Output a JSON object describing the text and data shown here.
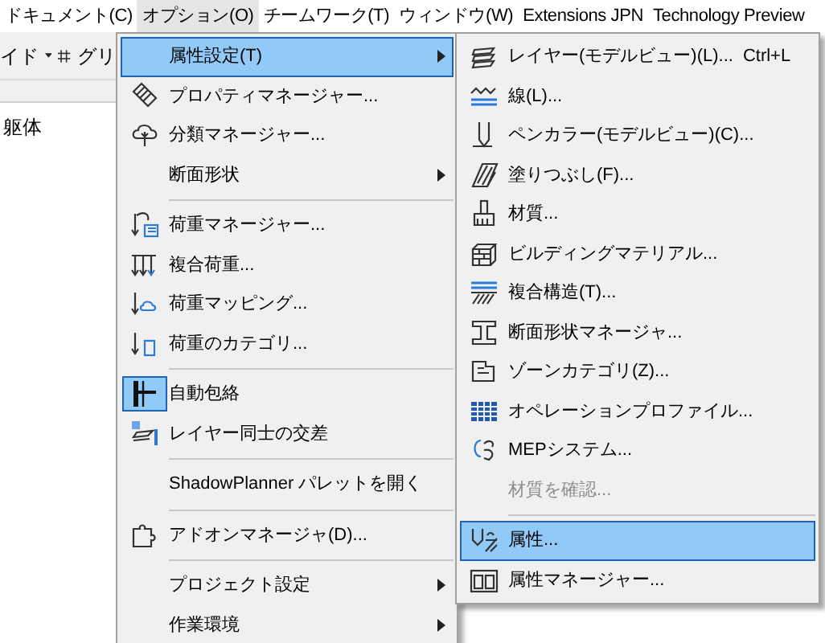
{
  "menubar": [
    {
      "label": "ドキュメント(C)",
      "selected": false
    },
    {
      "label": "オプション(O)",
      "selected": true
    },
    {
      "label": "チームワーク(T)",
      "selected": false
    },
    {
      "label": "ウィンドウ(W)",
      "selected": false
    },
    {
      "label": "Extensions JPN",
      "selected": false
    },
    {
      "label": "Technology Preview",
      "selected": false
    }
  ],
  "toolbar": {
    "left_label": "イド",
    "grid_label": "グリ"
  },
  "tree": {
    "item": "躯体"
  },
  "options_menu": {
    "groups": [
      [
        {
          "label": "属性設定(T)",
          "submenu": true,
          "selected": true,
          "checked": false
        },
        {
          "label": "プロパティマネージャー...",
          "submenu": false,
          "selected": false,
          "checked": false
        },
        {
          "label": "分類マネージャー...",
          "submenu": false,
          "selected": false,
          "checked": false
        },
        {
          "label": "断面形状",
          "submenu": true,
          "selected": false,
          "checked": false
        }
      ],
      [
        {
          "label": "荷重マネージャー...",
          "submenu": false,
          "selected": false,
          "checked": false
        },
        {
          "label": "複合荷重...",
          "submenu": false,
          "selected": false,
          "checked": false
        },
        {
          "label": "荷重マッピング...",
          "submenu": false,
          "selected": false,
          "checked": false
        },
        {
          "label": "荷重のカテゴリ...",
          "submenu": false,
          "selected": false,
          "checked": false
        }
      ],
      [
        {
          "label": "自動包絡",
          "submenu": false,
          "selected": false,
          "checked": true
        },
        {
          "label": "レイヤー同士の交差",
          "submenu": false,
          "selected": false,
          "checked": false
        }
      ],
      [
        {
          "label": "ShadowPlanner パレットを開く",
          "submenu": false,
          "selected": false,
          "checked": false
        }
      ],
      [
        {
          "label": "アドオンマネージャ(D)...",
          "submenu": false,
          "selected": false,
          "checked": false
        }
      ],
      [
        {
          "label": "プロジェクト設定",
          "submenu": true,
          "selected": false,
          "checked": false
        },
        {
          "label": "作業環境",
          "submenu": true,
          "selected": false,
          "checked": false
        }
      ]
    ]
  },
  "attributes_submenu": {
    "groups": [
      [
        {
          "label": "レイヤー(モデルビュー)(L)...",
          "shortcut": "Ctrl+L",
          "selected": false,
          "disabled": false
        },
        {
          "label": "線(L)...",
          "selected": false,
          "disabled": false
        },
        {
          "label": "ペンカラー(モデルビュー)(C)...",
          "selected": false,
          "disabled": false
        },
        {
          "label": "塗りつぶし(F)...",
          "selected": false,
          "disabled": false
        },
        {
          "label": "材質...",
          "selected": false,
          "disabled": false
        },
        {
          "label": "ビルディングマテリアル...",
          "selected": false,
          "disabled": false
        },
        {
          "label": "複合構造(T)...",
          "selected": false,
          "disabled": false
        },
        {
          "label": "断面形状マネージャ...",
          "selected": false,
          "disabled": false
        },
        {
          "label": "ゾーンカテゴリ(Z)...",
          "selected": false,
          "disabled": false
        },
        {
          "label": "オペレーションプロファイル...",
          "selected": false,
          "disabled": false
        },
        {
          "label": "MEPシステム...",
          "selected": false,
          "disabled": false
        },
        {
          "label": "材質を確認...",
          "selected": false,
          "disabled": true
        }
      ],
      [
        {
          "label": "属性...",
          "selected": true,
          "disabled": false
        },
        {
          "label": "属性マネージャー...",
          "selected": false,
          "disabled": false
        }
      ]
    ]
  }
}
